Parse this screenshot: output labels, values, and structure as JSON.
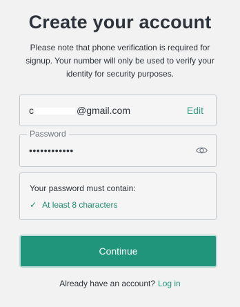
{
  "header": {
    "title": "Create your account",
    "subtitle": "Please note that phone verification is required for signup. Your number will only be used to verify your identity for security purposes."
  },
  "email": {
    "prefix": "c",
    "suffix": "@gmail.com",
    "edit_label": "Edit"
  },
  "password": {
    "legend": "Password",
    "masked_value": "••••••••••••",
    "toggle_icon": "eye-icon"
  },
  "rules": {
    "title": "Your password must contain:",
    "items": [
      {
        "check": "✓",
        "label": "At least 8 characters"
      }
    ]
  },
  "actions": {
    "continue_label": "Continue"
  },
  "footer": {
    "prompt": "Already have an account?",
    "login_label": "Log in"
  },
  "colors": {
    "accent": "#20957b",
    "link": "#3b9c86",
    "background": "#f2f2f2"
  }
}
